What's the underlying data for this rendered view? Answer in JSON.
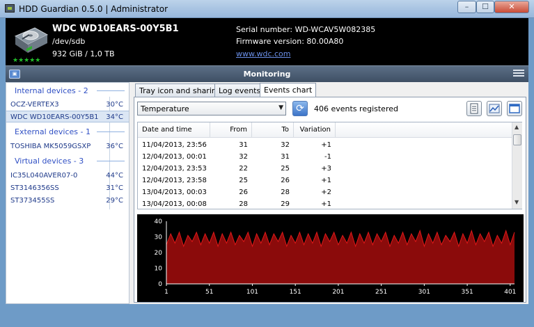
{
  "window": {
    "title": "HDD Guardian 0.5.0 | Administrator",
    "minimize": "–",
    "maximize": "☐",
    "close": "✕"
  },
  "device": {
    "name": "WDC WD10EARS-00Y5B1",
    "path": "/dev/sdb",
    "size": "932 GiB / 1,0 TB",
    "serial": "Serial number: WD-WCAV5W082385",
    "firmware": "Firmware version: 80.00A80",
    "website": "www.wdc.com",
    "rating": "★★★★★",
    "icon": "hard-drive-icon"
  },
  "toolbar": {
    "title": "Monitoring",
    "left_icon": "monitor-icon",
    "left_glyph": "▣",
    "menu_icon": "hamburger-menu-icon"
  },
  "devices": {
    "internal_label": "Internal devices - 2",
    "internal": [
      {
        "name": "OCZ-VERTEX3",
        "temp": "30°C"
      },
      {
        "name": "WDC WD10EARS-00Y5B1",
        "temp": "34°C"
      }
    ],
    "external_label": "External devices - 1",
    "external": [
      {
        "name": "TOSHIBA MK5059GSXP",
        "temp": "36°C"
      }
    ],
    "virtual_label": "Virtual devices - 3",
    "virtual": [
      {
        "name": "IC35L040AVER07-0",
        "temp": "44°C"
      },
      {
        "name": "ST3146356SS",
        "temp": "31°C"
      },
      {
        "name": "ST373455SS",
        "temp": "29°C"
      }
    ]
  },
  "tabs": [
    "Tray icon and sharing",
    "Log events",
    "Events chart"
  ],
  "events": {
    "selector": "Temperature",
    "count_text": "406 events registered",
    "refresh_glyph": "⟳",
    "columns": [
      "Date and time",
      "From",
      "To",
      "Variation"
    ],
    "rows": [
      [
        "11/04/2013, 23:56",
        "31",
        "32",
        "+1"
      ],
      [
        "12/04/2013, 00:01",
        "32",
        "31",
        "-1"
      ],
      [
        "12/04/2013, 23:53",
        "22",
        "25",
        "+3"
      ],
      [
        "12/04/2013, 23:58",
        "25",
        "26",
        "+1"
      ],
      [
        "13/04/2013, 00:03",
        "26",
        "28",
        "+2"
      ],
      [
        "13/04/2013, 00:08",
        "28",
        "29",
        "+1"
      ]
    ]
  },
  "colors": {
    "chart_fill": "#8b0b0b",
    "chart_line": "#e01818",
    "chart_bg": "#000000",
    "grid": "#555555"
  },
  "chart_data": {
    "type": "area",
    "x_ticks": [
      1,
      51,
      101,
      151,
      201,
      251,
      301,
      351,
      401
    ],
    "y_ticks": [
      0,
      10,
      20,
      30,
      40
    ],
    "xlim": [
      1,
      406
    ],
    "ylim": [
      0,
      40
    ],
    "grid": false,
    "series": [
      {
        "x": [
          1,
          6,
          11,
          16,
          21,
          26,
          31,
          36,
          41,
          46,
          51,
          56,
          61,
          66,
          71,
          76,
          81,
          86,
          91,
          96,
          101,
          106,
          111,
          116,
          121,
          126,
          131,
          136,
          141,
          146,
          151,
          156,
          161,
          166,
          171,
          176,
          181,
          186,
          191,
          196,
          201,
          206,
          211,
          216,
          221,
          226,
          231,
          236,
          241,
          246,
          251,
          256,
          261,
          266,
          271,
          276,
          281,
          286,
          291,
          296,
          301,
          306,
          311,
          316,
          321,
          326,
          331,
          336,
          341,
          346,
          351,
          356,
          361,
          366,
          371,
          376,
          381,
          386,
          391,
          396,
          401,
          406
        ],
        "values": [
          25,
          32,
          26,
          33,
          24,
          31,
          27,
          33,
          25,
          32,
          26,
          33,
          24,
          32,
          26,
          33,
          25,
          31,
          27,
          33,
          24,
          32,
          26,
          33,
          25,
          32,
          27,
          33,
          24,
          31,
          26,
          33,
          25,
          32,
          26,
          33,
          24,
          32,
          27,
          33,
          25,
          31,
          26,
          33,
          24,
          32,
          26,
          33,
          25,
          32,
          27,
          33,
          24,
          31,
          26,
          33,
          25,
          32,
          27,
          34,
          24,
          32,
          26,
          33,
          25,
          31,
          27,
          33,
          24,
          32,
          26,
          34,
          25,
          32,
          27,
          33,
          24,
          31,
          26,
          34,
          25,
          33
        ]
      }
    ]
  }
}
